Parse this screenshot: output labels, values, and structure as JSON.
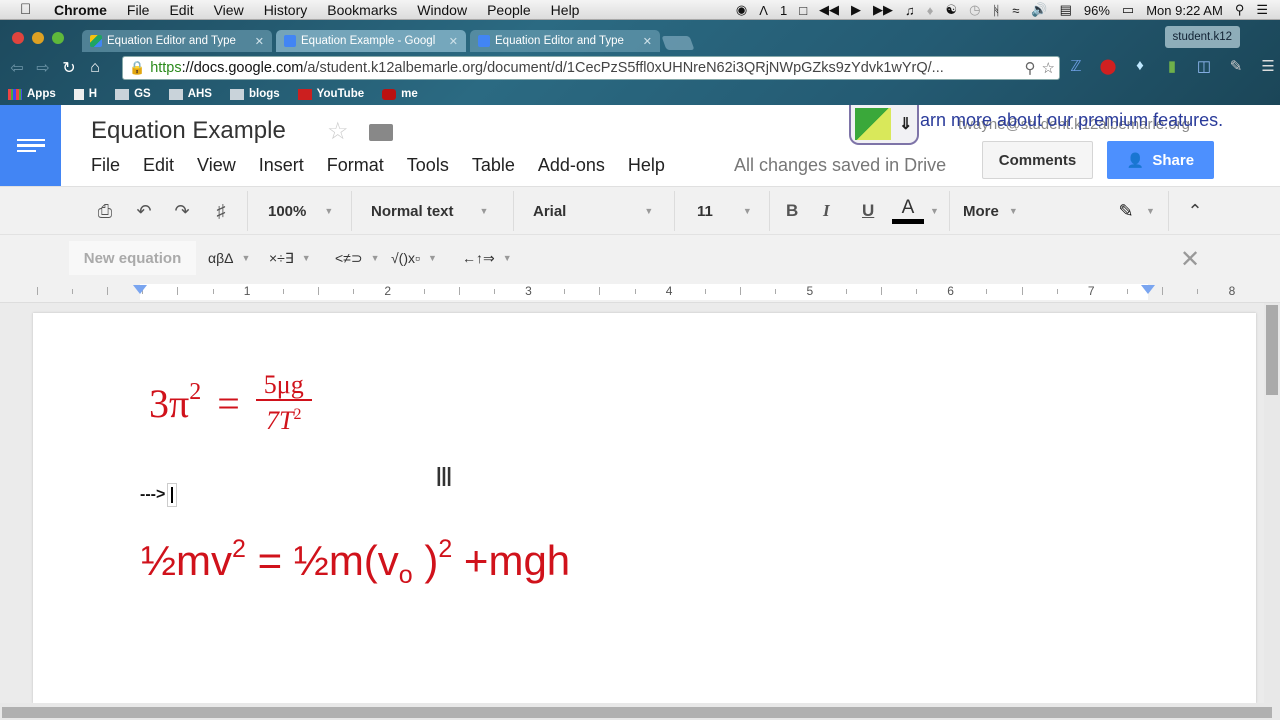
{
  "mac_menubar": {
    "app": "Chrome",
    "items": [
      "File",
      "Edit",
      "View",
      "History",
      "Bookmarks",
      "Window",
      "People",
      "Help"
    ],
    "status": {
      "adobe_count": "1",
      "battery": "96%",
      "clock": "Mon 9:22 AM"
    }
  },
  "browser": {
    "tabs": [
      {
        "title": "Equation Editor and Type",
        "icon": "google-drive-icon",
        "active": false
      },
      {
        "title": "Equation Example - Googl",
        "icon": "google-docs-icon",
        "active": true
      },
      {
        "title": "Equation Editor and Type",
        "icon": "google-docs-icon",
        "active": false
      }
    ],
    "profile": "student.k12",
    "url": {
      "scheme": "https",
      "host": "://docs.google.com",
      "path": "/a/student.k12albemarle.org/document/d/1CecPzS5ffl0xUHNreN62i3QRjNWpGZks9zYdvk1wYrQ/..."
    },
    "bookmarks": [
      {
        "label": "Apps",
        "icon": "apps-grid-icon"
      },
      {
        "label": "H",
        "icon": "page-icon"
      },
      {
        "label": "GS",
        "icon": "folder-icon"
      },
      {
        "label": "AHS",
        "icon": "folder-icon"
      },
      {
        "label": "blogs",
        "icon": "folder-icon"
      },
      {
        "label": "YouTube",
        "icon": "youtube-icon"
      },
      {
        "label": "me",
        "icon": "avatar-icon"
      }
    ]
  },
  "docs": {
    "title": "Equation Example",
    "menu": [
      "File",
      "Edit",
      "View",
      "Insert",
      "Format",
      "Tools",
      "Table",
      "Add-ons",
      "Help"
    ],
    "save_status": "All changes saved in Drive",
    "account": "twayne@student.k12albemarle.org",
    "premium_banner": "arn more about our premium features.",
    "comments_label": "Comments",
    "share_label": "Share",
    "toolbar": {
      "zoom": "100%",
      "style": "Normal text",
      "font": "Arial",
      "size": "11",
      "bold": "B",
      "italic": "I",
      "underline": "U",
      "text_color": "A",
      "more": "More"
    },
    "equation_toolbar": {
      "new_equation": "New equation",
      "menus": [
        "αβΔ",
        "×÷∃",
        "<≠⊃",
        "√()x▫",
        "←↑⇒"
      ]
    },
    "ruler": {
      "numbers": [
        "1",
        "2",
        "3",
        "4",
        "5",
        "6",
        "7",
        "8"
      ]
    },
    "content": {
      "eq1": {
        "lhs": "3π",
        "lhs_exp": "2",
        "equals": "=",
        "numerator": "5μg",
        "denominator": "7T",
        "denominator_exp": "2"
      },
      "arrow_text": "--->",
      "eq2": {
        "part1": "½mv",
        "exp1": "2",
        "part2": " = ½m(v",
        "sub": "o",
        "part3": " )",
        "exp2": "2",
        "part4": " +mgh"
      }
    },
    "colors": {
      "accent": "#4285f4",
      "share_button": "#4d90fe",
      "equation_red": "#d0121b"
    }
  }
}
